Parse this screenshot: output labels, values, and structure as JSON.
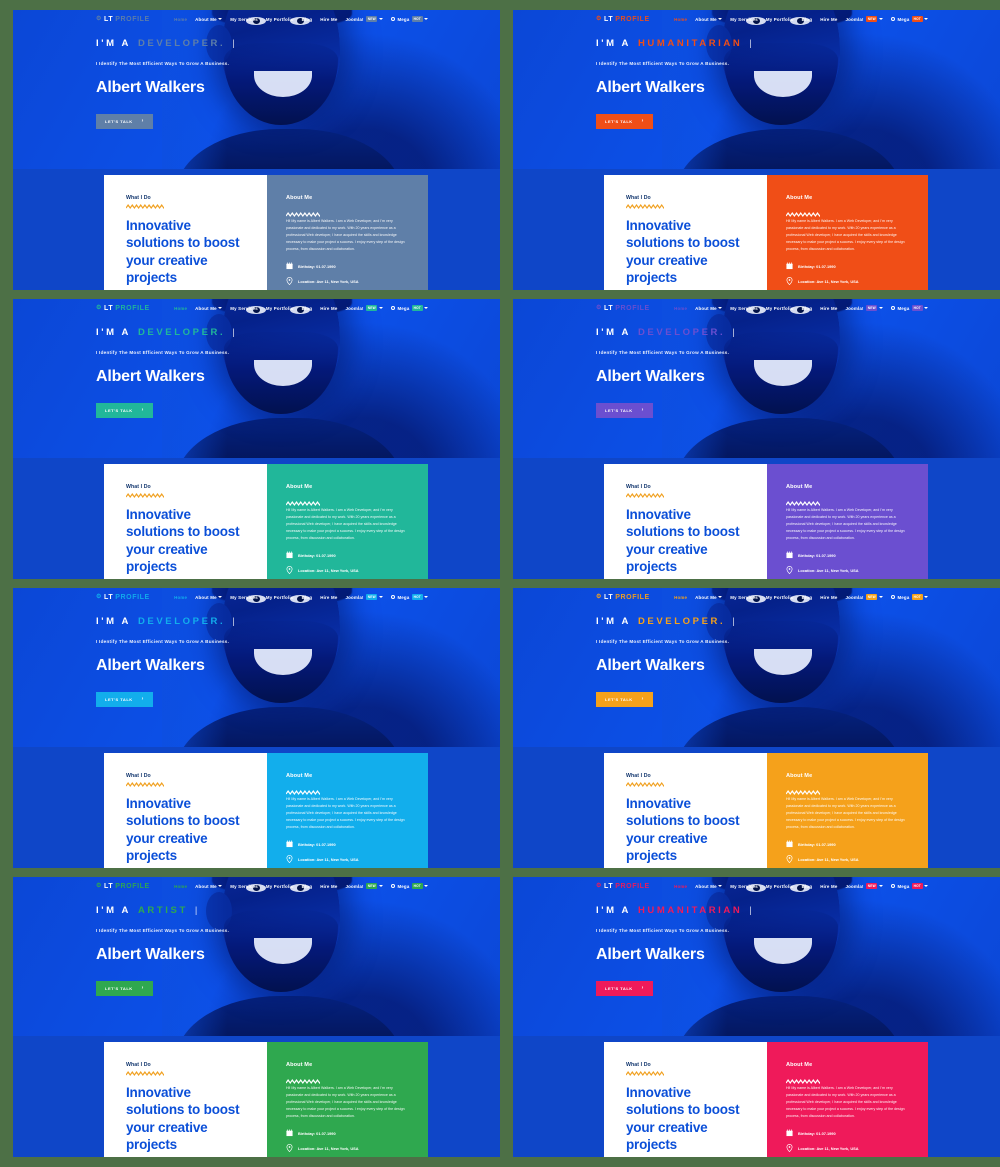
{
  "page": {
    "background_color": "#4d7046",
    "layout": "2x4 grid of website template previews"
  },
  "shared": {
    "logo": {
      "mark": "⚙",
      "lt": "LT",
      "profile": " PROFILE"
    },
    "nav": [
      {
        "label": "Home",
        "active": true,
        "caret": false
      },
      {
        "label": "About Me",
        "active": false,
        "caret": true
      },
      {
        "label": "My Services",
        "active": false,
        "caret": false
      },
      {
        "label": "My Portfolio",
        "active": false,
        "caret": false
      },
      {
        "label": "Blog",
        "active": false,
        "caret": false
      },
      {
        "label": "Hire Me",
        "active": false,
        "caret": false
      },
      {
        "label": "Joomla!",
        "active": false,
        "caret": true,
        "badge": "NEW"
      },
      {
        "label": "Mega",
        "active": false,
        "caret": true,
        "badge": "HOT",
        "gear": true
      }
    ],
    "hero": {
      "prefix": "I'M A",
      "cursor": "|",
      "subline": "I Identify The Most Efficient Ways To Grow A Business.",
      "name": "Albert Walkers",
      "cta_label": "LET'S TALK",
      "cta_arrow": "›"
    },
    "what_i_do": {
      "label": "What I Do",
      "title": "Innovative solutions to boost your creative projects"
    },
    "about": {
      "heading": "About Me",
      "paragraph": "Hi! My name is Albert Walkers. I am a Web Developer, and I'm very passionate and dedicated to my work. With 20 years experience as a professional Web developer, I have acquired the skills and knowledge necessary to make your project a success. I enjoy every step of the design process, from discussion and collaboration.",
      "birthday_label": "Birthday:",
      "birthday_value": "01.07.1990",
      "location_label": "Location:",
      "location_value": "Ave 11, New York, USA",
      "birthday_icon": "calendar-icon",
      "location_icon": "map-pin-icon"
    }
  },
  "panels": [
    {
      "id": "panel-1",
      "role": "DEVELOPER.",
      "accent": "#5f7fa8",
      "accent_name": "muted-blue",
      "hero_bg": "#0d4fe0"
    },
    {
      "id": "panel-2",
      "role": "HUMANITARIAN",
      "accent": "#f04e17",
      "accent_name": "orange-red",
      "hero_bg": "#0d4fe0"
    },
    {
      "id": "panel-3",
      "role": "DEVELOPER.",
      "accent": "#21b79a",
      "accent_name": "teal",
      "hero_bg": "#0d4fe0"
    },
    {
      "id": "panel-4",
      "role": "DEVELOPER.",
      "accent": "#6b4fd0",
      "accent_name": "purple",
      "hero_bg": "#0d4fe0"
    },
    {
      "id": "panel-5",
      "role": "DEVELOPER.",
      "accent": "#12aeec",
      "accent_name": "cyan",
      "hero_bg": "#0d4fe0"
    },
    {
      "id": "panel-6",
      "role": "DEVELOPER.",
      "accent": "#f5a11b",
      "accent_name": "amber",
      "hero_bg": "#0d4fe0"
    },
    {
      "id": "panel-7",
      "role": "ARTIST",
      "accent": "#2fa84f",
      "accent_name": "green",
      "hero_bg": "#0d4fe0"
    },
    {
      "id": "panel-8",
      "role": "HUMANITARIAN",
      "accent": "#ef1a5a",
      "accent_name": "pink-red",
      "hero_bg": "#0d4fe0"
    }
  ]
}
